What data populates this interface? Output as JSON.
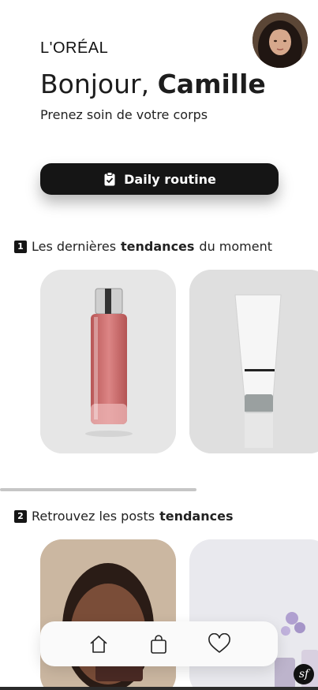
{
  "brand": {
    "logo_text": "L'ORÉAL"
  },
  "greeting": {
    "hello": "Bonjour,",
    "name": "Camille",
    "subtitle": "Prenez soin de votre corps"
  },
  "routine_button": {
    "label": "Daily routine",
    "icon": "clipboard-check-icon"
  },
  "section_trends": {
    "number": "1",
    "text_before": "Les dernières",
    "bold": "tendances",
    "text_after": "du moment",
    "scroll_progress": 0.62
  },
  "products": [
    {
      "name": "red-serum-bottle",
      "color": "#c86a6a"
    },
    {
      "name": "white-cream-tube",
      "color": "#f2f2f2"
    }
  ],
  "section_posts": {
    "number": "2",
    "text_before": "Retrouvez les posts",
    "bold": "tendances"
  },
  "nav": {
    "items": [
      "home-icon",
      "shopping-bag-icon",
      "heart-icon"
    ]
  },
  "badge": {
    "text": "sf"
  },
  "colors": {
    "primary": "#151515",
    "background": "#ffffff"
  }
}
